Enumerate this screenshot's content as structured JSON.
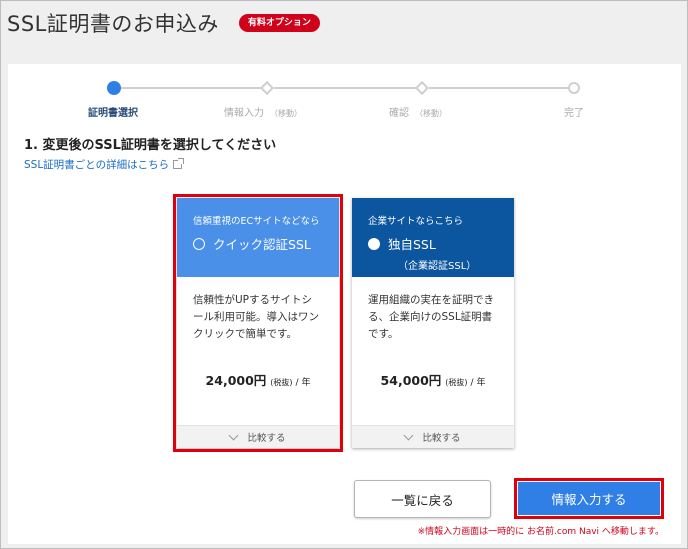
{
  "header": {
    "title": "SSL証明書のお申込み",
    "badge": "有料オプション"
  },
  "stepper": {
    "steps": [
      {
        "label": "証明書選択",
        "sub": ""
      },
      {
        "label": "情報入力",
        "sub": "（移動）"
      },
      {
        "label": "確認",
        "sub": "（移動）"
      },
      {
        "label": "完了",
        "sub": ""
      }
    ]
  },
  "section": {
    "heading": "1. 変更後のSSL証明書を選択してください",
    "link": "SSL証明書ごとの詳細はこちら"
  },
  "cards": [
    {
      "tag": "信頼重視のECサイトなどなら",
      "name": "クイック認証SSL",
      "sub": "",
      "desc": "信頼性がUPするサイトシール利用可能。導入はワンクリックで簡単です。",
      "price": "24,000円",
      "tax": "(税抜)",
      "unit": "/ 年",
      "compare": "比較する"
    },
    {
      "tag": "企業サイトならこちら",
      "name": "独自SSL",
      "sub": "（企業認証SSL）",
      "desc": "運用組織の実在を証明できる、企業向けのSSL証明書です。",
      "price": "54,000円",
      "tax": "(税抜)",
      "unit": "/ 年",
      "compare": "比較する"
    }
  ],
  "actions": {
    "back_label": "一覧に戻る",
    "next_label": "情報入力する",
    "note": "※情報入力画面は一時的に お名前.com Navi へ移動します。"
  },
  "colors": {
    "accent": "#2f7fe6",
    "card1_header": "#4a8fe8",
    "card2_header": "#0c56a0",
    "highlight": "#e0000b",
    "badge": "#d0021b"
  }
}
